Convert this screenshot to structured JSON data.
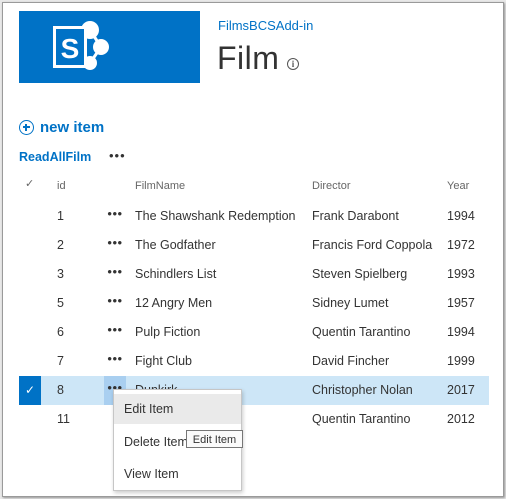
{
  "site": {
    "breadcrumb": "FilmsBCSAdd-in",
    "title": "Film",
    "info_icon": "info-icon",
    "logo_icon": "sharepoint-logo-icon",
    "brand_color": "#0072c6"
  },
  "toolbar": {
    "new_item_label": "new item",
    "new_item_icon": "plus-circle-icon"
  },
  "view": {
    "name": "ReadAllFilm",
    "more_label": "•••"
  },
  "columns": {
    "check": "✓",
    "id": "id",
    "film_name": "FilmName",
    "director": "Director",
    "year": "Year"
  },
  "rows": [
    {
      "id": "1",
      "film_name": "The Shawshank Redemption",
      "director": "Frank Darabont",
      "year": "1994",
      "ellipsis": "•••"
    },
    {
      "id": "2",
      "film_name": "The Godfather",
      "director": "Francis Ford Coppola",
      "year": "1972",
      "ellipsis": "•••"
    },
    {
      "id": "3",
      "film_name": "Schindlers List",
      "director": "Steven Spielberg",
      "year": "1993",
      "ellipsis": "•••"
    },
    {
      "id": "5",
      "film_name": "12 Angry Men",
      "director": "Sidney Lumet",
      "year": "1957",
      "ellipsis": "•••"
    },
    {
      "id": "6",
      "film_name": "Pulp Fiction",
      "director": "Quentin Tarantino",
      "year": "1994",
      "ellipsis": "•••"
    },
    {
      "id": "7",
      "film_name": "Fight Club",
      "director": "David Fincher",
      "year": "1999",
      "ellipsis": "•••"
    },
    {
      "id": "8",
      "film_name": "Dunkirk",
      "director": "Christopher Nolan",
      "year": "2017",
      "ellipsis": "•••",
      "selected": true,
      "check": "✓"
    },
    {
      "id": "11",
      "film_name": "",
      "director": "Quentin Tarantino",
      "year": "2012",
      "ellipsis": ""
    }
  ],
  "context_menu": {
    "items": [
      {
        "label": "Edit Item"
      },
      {
        "label": "Delete Item"
      },
      {
        "label": "View Item"
      }
    ],
    "tooltip": "Edit Item"
  },
  "colors": {
    "selected_row": "#cde6f7",
    "hover_item": "#eaeaea",
    "link": "#0072c6"
  }
}
